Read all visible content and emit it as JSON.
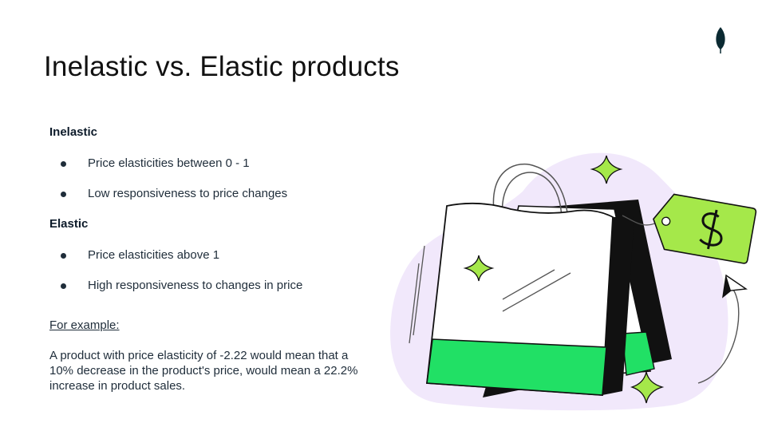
{
  "slide": {
    "title": "Inelastic vs. Elastic products",
    "sections": [
      {
        "heading": "Inelastic",
        "bullets": [
          "Price elasticities between 0 - 1",
          "Low responsiveness to price changes"
        ]
      },
      {
        "heading": "Elastic",
        "bullets": [
          "Price elasticities above 1",
          "High responsiveness to changes in price"
        ]
      }
    ],
    "example_label": "For example:",
    "example_text": "A product with price elasticity of -2.22 would mean that a 10% decrease in the product's price, would mean a 22.2% increase in product sales."
  },
  "colors": {
    "accent_green": "#21e065",
    "tag_green": "#a5e84a",
    "blob_purple": "#f1e8fb",
    "leaf_dark": "#0b2a32"
  },
  "icons": [
    "leaf-icon",
    "shopping-bags-illustration",
    "price-tag-icon",
    "sparkle-icon",
    "cursor-arrow-icon"
  ]
}
